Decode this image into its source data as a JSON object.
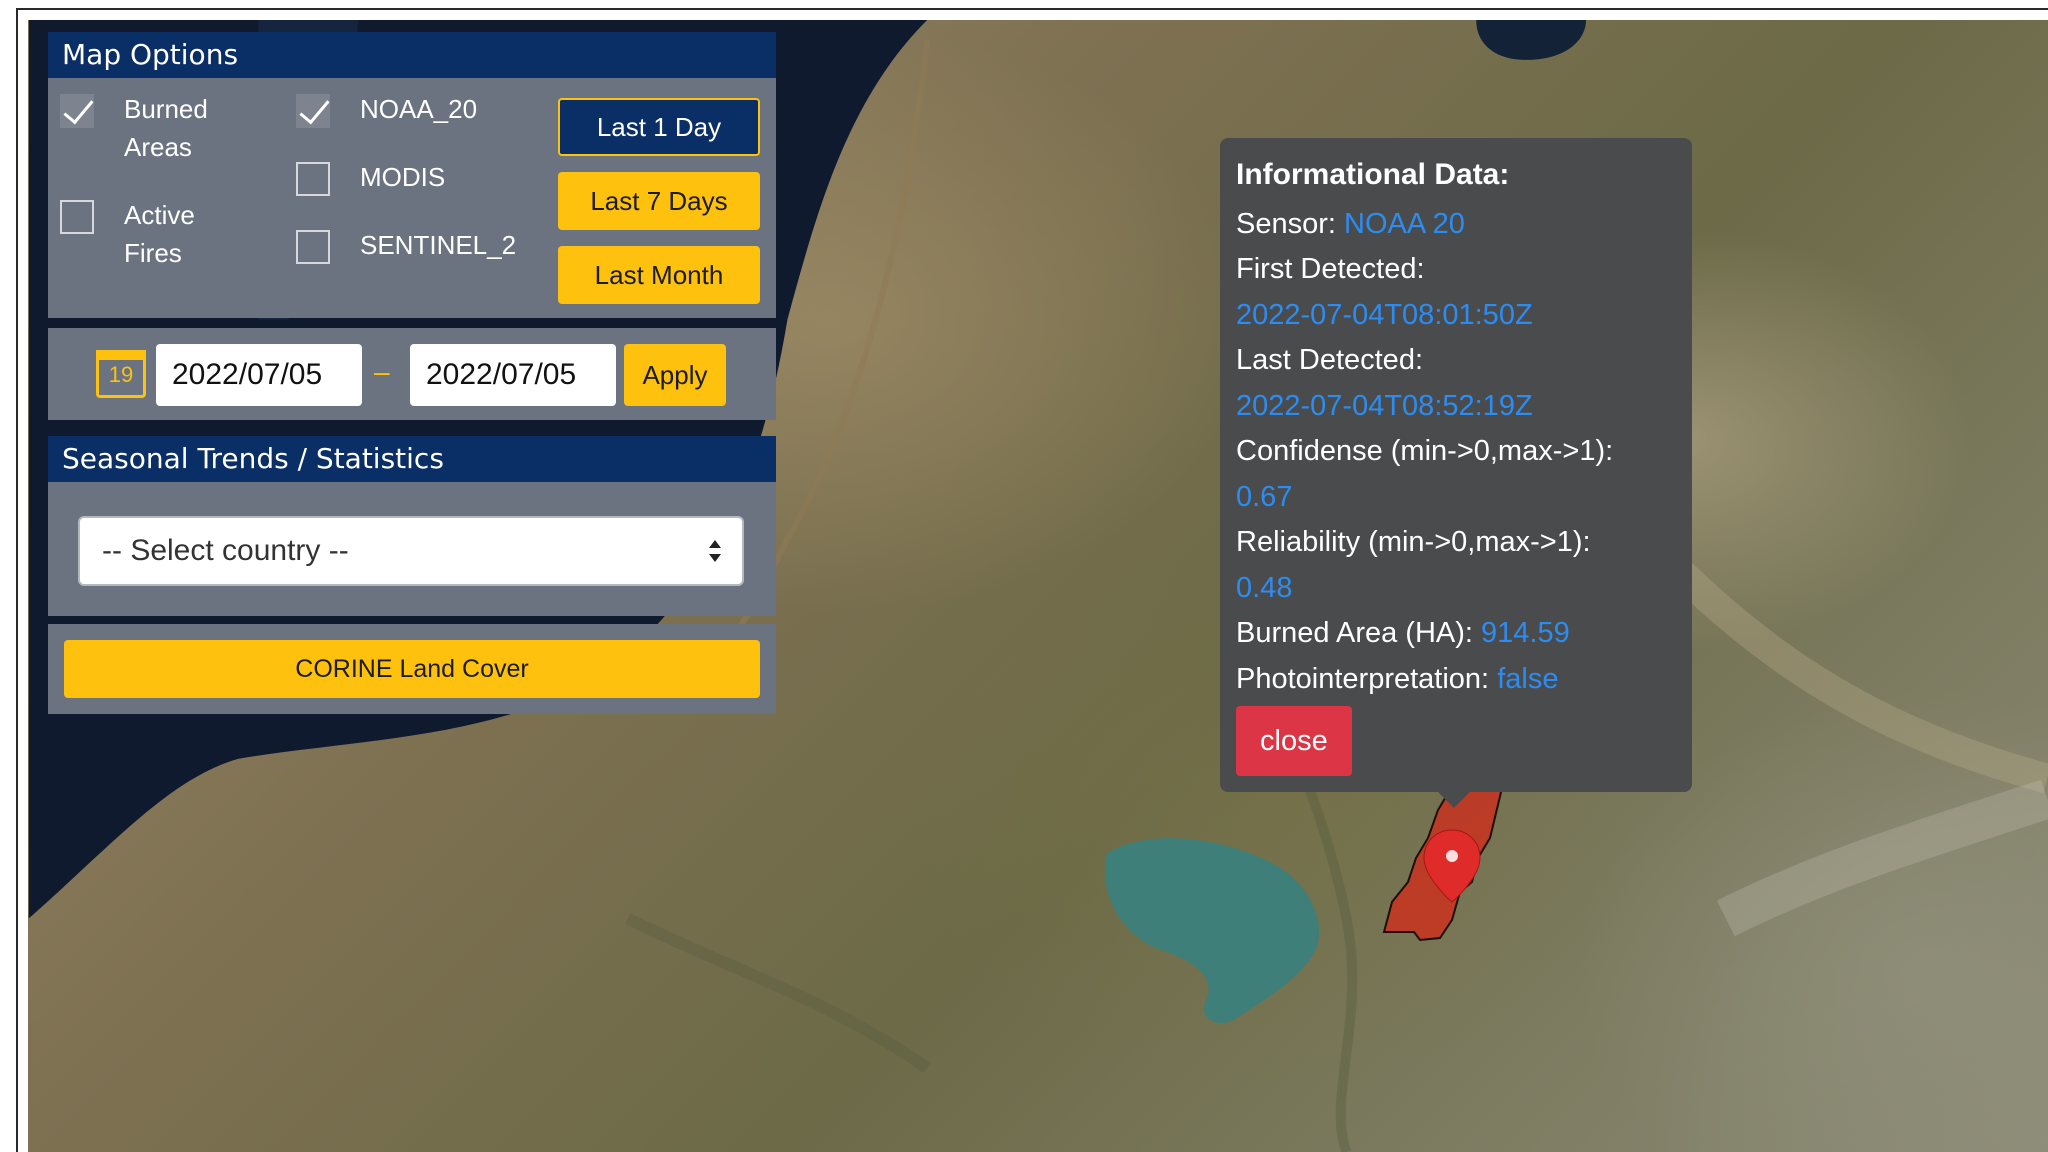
{
  "map_options": {
    "title": "Map Options",
    "layers": [
      {
        "label_line1": "Burned",
        "label_line2": "Areas",
        "checked": true
      },
      {
        "label_line1": "Active",
        "label_line2": "Fires",
        "checked": false
      }
    ],
    "sensors": [
      {
        "label": "NOAA_20",
        "checked": true
      },
      {
        "label": "MODIS",
        "checked": false
      },
      {
        "label": "SENTINEL_2",
        "checked": false
      }
    ],
    "time_buttons": [
      {
        "label": "Last 1 Day",
        "active": true
      },
      {
        "label": "Last 7 Days",
        "active": false
      },
      {
        "label": "Last Month",
        "active": false
      }
    ]
  },
  "date_range": {
    "calendar_day": "19",
    "start": "2022/07/05",
    "separator": "–",
    "end": "2022/07/05",
    "apply_label": "Apply"
  },
  "seasonal": {
    "title": "Seasonal Trends / Statistics",
    "country_select": "-- Select country --"
  },
  "corine": {
    "label": "CORINE Land Cover"
  },
  "popup": {
    "title": "Informational Data:",
    "sensor_label": "Sensor:",
    "sensor_value": "NOAA 20",
    "first_detected_label": "First Detected:",
    "first_detected_value": "2022-07-04T08:01:50Z",
    "last_detected_label": "Last Detected:",
    "last_detected_value": "2022-07-04T08:52:19Z",
    "confidence_label": "Confidense (min->0,max->1):",
    "confidence_value": "0.67",
    "reliability_label": "Reliability (min->0,max->1):",
    "reliability_value": "0.48",
    "burned_area_label": "Burned Area (HA):",
    "burned_area_value": "914.59",
    "photo_label": "Photointerpretation:",
    "photo_value": "false",
    "close_label": "close"
  },
  "colors": {
    "panel_header": "#0a2e66",
    "accent_yellow": "#fdc10e",
    "value_blue": "#2d8cf0",
    "close_red": "#dc3545",
    "burned_area_fill": "#c8321e"
  }
}
